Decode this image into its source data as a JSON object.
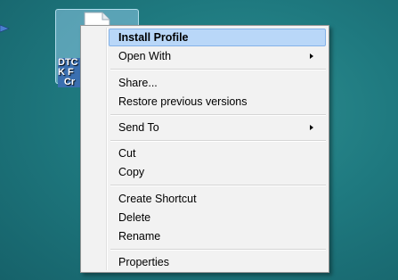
{
  "desktop_icon": {
    "caption_lines": [
      "DTC",
      "K F",
      "Cr"
    ]
  },
  "context_menu": {
    "items": [
      {
        "label": "Install Profile",
        "default": true,
        "highlighted": true,
        "submenu": false
      },
      {
        "label": "Open With",
        "submenu": true
      },
      {
        "label": "Share..."
      },
      {
        "label": "Restore previous versions"
      },
      {
        "label": "Send To",
        "submenu": true
      },
      {
        "label": "Cut"
      },
      {
        "label": "Copy"
      },
      {
        "label": "Create Shortcut"
      },
      {
        "label": "Delete"
      },
      {
        "label": "Rename"
      },
      {
        "label": "Properties"
      }
    ]
  },
  "colors": {
    "desktop": "#1f7a80",
    "menu_background": "#f2f2f2",
    "highlight": "#b9d7f8",
    "highlight_border": "#84b2e8"
  },
  "icons": {
    "cursor": "arrow-cursor-icon",
    "file": "file-icon",
    "submenu": "submenu-arrow-icon"
  }
}
